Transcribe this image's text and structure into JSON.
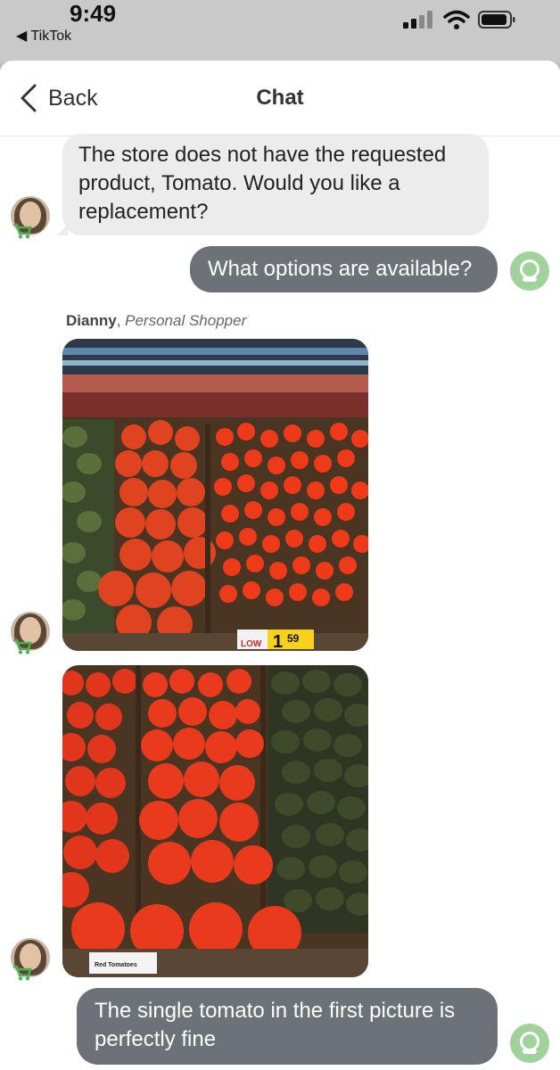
{
  "status_bar": {
    "time": "9:49",
    "back_app": "◀ TikTok"
  },
  "nav": {
    "back_label": "Back",
    "title": "Chat"
  },
  "messages": {
    "m1": "The store does not have the requested product, Tomato. Would you like a replacement?",
    "m2": "What options are available?",
    "sender_name": "Dianny",
    "sender_role": "Personal Shopper",
    "photo1_price": "1",
    "photo1_price_cents": "59",
    "photo1_tag": "LOW",
    "photo2_label": "Red Tomatoes",
    "m3": "The single tomato in the first picture is perfectly fine"
  },
  "colors": {
    "incoming_bubble": "#ececec",
    "outgoing_bubble": "#6d7278",
    "accent_green": "#4caf50"
  },
  "icons": [
    "chevron-left-icon",
    "signal-icon",
    "wifi-icon",
    "battery-icon",
    "cart-icon",
    "user-avatar-icon"
  ]
}
